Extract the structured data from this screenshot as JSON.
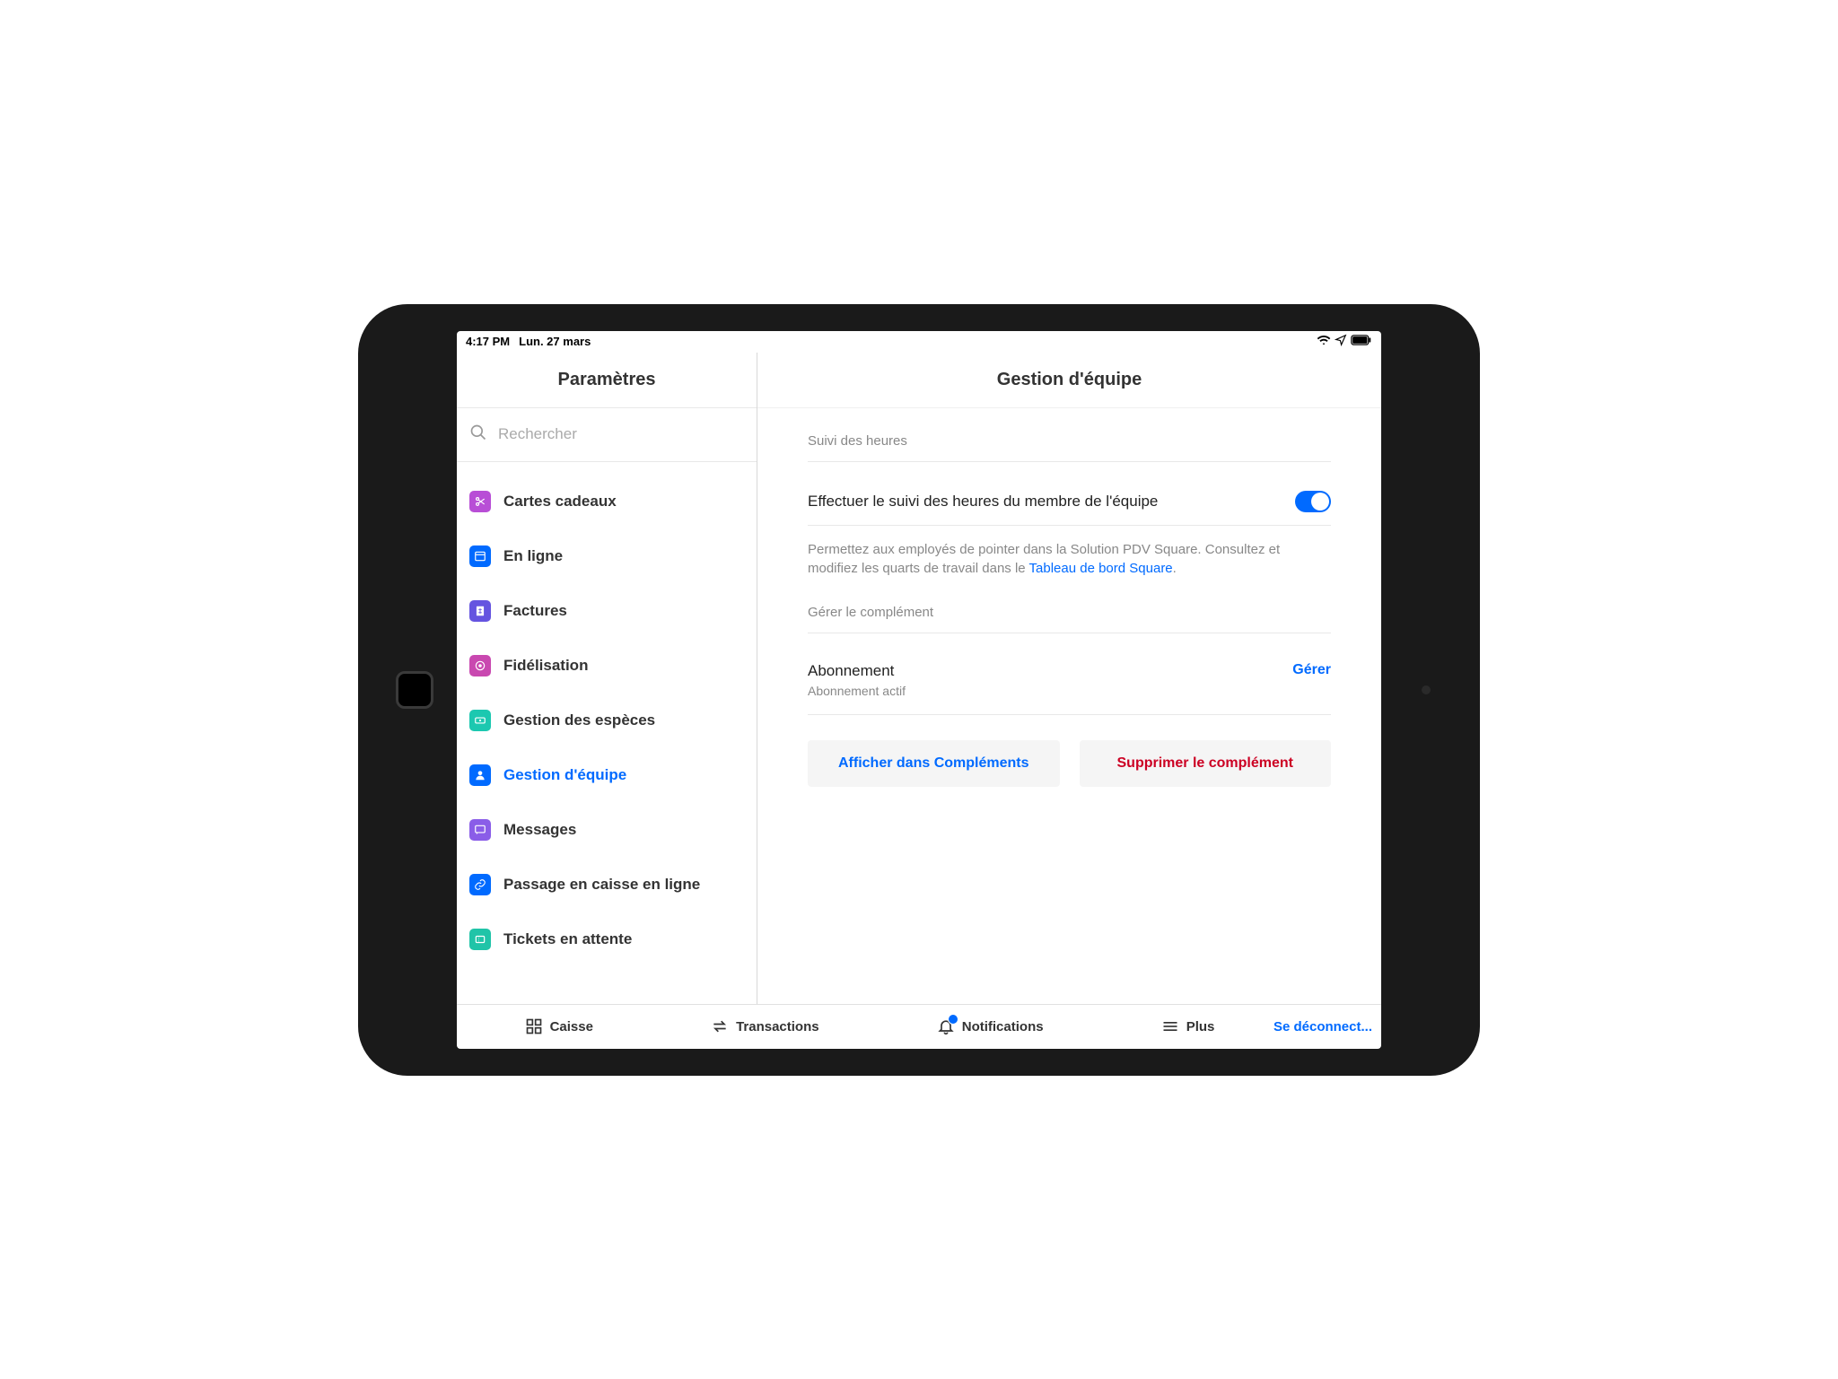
{
  "status": {
    "time": "4:17 PM",
    "date": "Lun. 27 mars"
  },
  "sidebar": {
    "title": "Paramètres",
    "search_placeholder": "Rechercher",
    "items": [
      {
        "label": "Cartes cadeaux",
        "icon": "scissors",
        "color": "#b84ed6"
      },
      {
        "label": "En ligne",
        "icon": "browser",
        "color": "#006aff"
      },
      {
        "label": "Factures",
        "icon": "invoice",
        "color": "#6554e0"
      },
      {
        "label": "Fidélisation",
        "icon": "target",
        "color": "#c948b0"
      },
      {
        "label": "Gestion des espèces",
        "icon": "cash",
        "color": "#1cc8b0"
      },
      {
        "label": "Gestion d'équipe",
        "icon": "person",
        "color": "#006aff",
        "active": true
      },
      {
        "label": "Messages",
        "icon": "chat",
        "color": "#8a5de8"
      },
      {
        "label": "Passage en caisse en ligne",
        "icon": "link",
        "color": "#006aff"
      },
      {
        "label": "Tickets en attente",
        "icon": "ticket",
        "color": "#20c4a8"
      }
    ]
  },
  "main": {
    "title": "Gestion d'équipe",
    "section1_title": "Suivi des heures",
    "toggle_label": "Effectuer le suivi des heures du membre de l'équipe",
    "toggle_on": true,
    "description_prefix": "Permettez aux employés de pointer dans la Solution PDV Square. Consultez et modifiez les quarts de travail dans le ",
    "description_link": "Tableau de bord Square",
    "description_suffix": ".",
    "section2_title": "Gérer le complément",
    "subscription_label": "Abonnement",
    "subscription_status": "Abonnement actif",
    "manage_link": "Gérer",
    "button_show": "Afficher dans Compléments",
    "button_delete": "Supprimer le complément"
  },
  "bottom": {
    "items": [
      {
        "label": "Caisse",
        "icon": "grid"
      },
      {
        "label": "Transactions",
        "icon": "swap"
      },
      {
        "label": "Notifications",
        "icon": "bell",
        "badge": true
      },
      {
        "label": "Plus",
        "icon": "menu"
      }
    ],
    "logout": "Se déconnect..."
  }
}
